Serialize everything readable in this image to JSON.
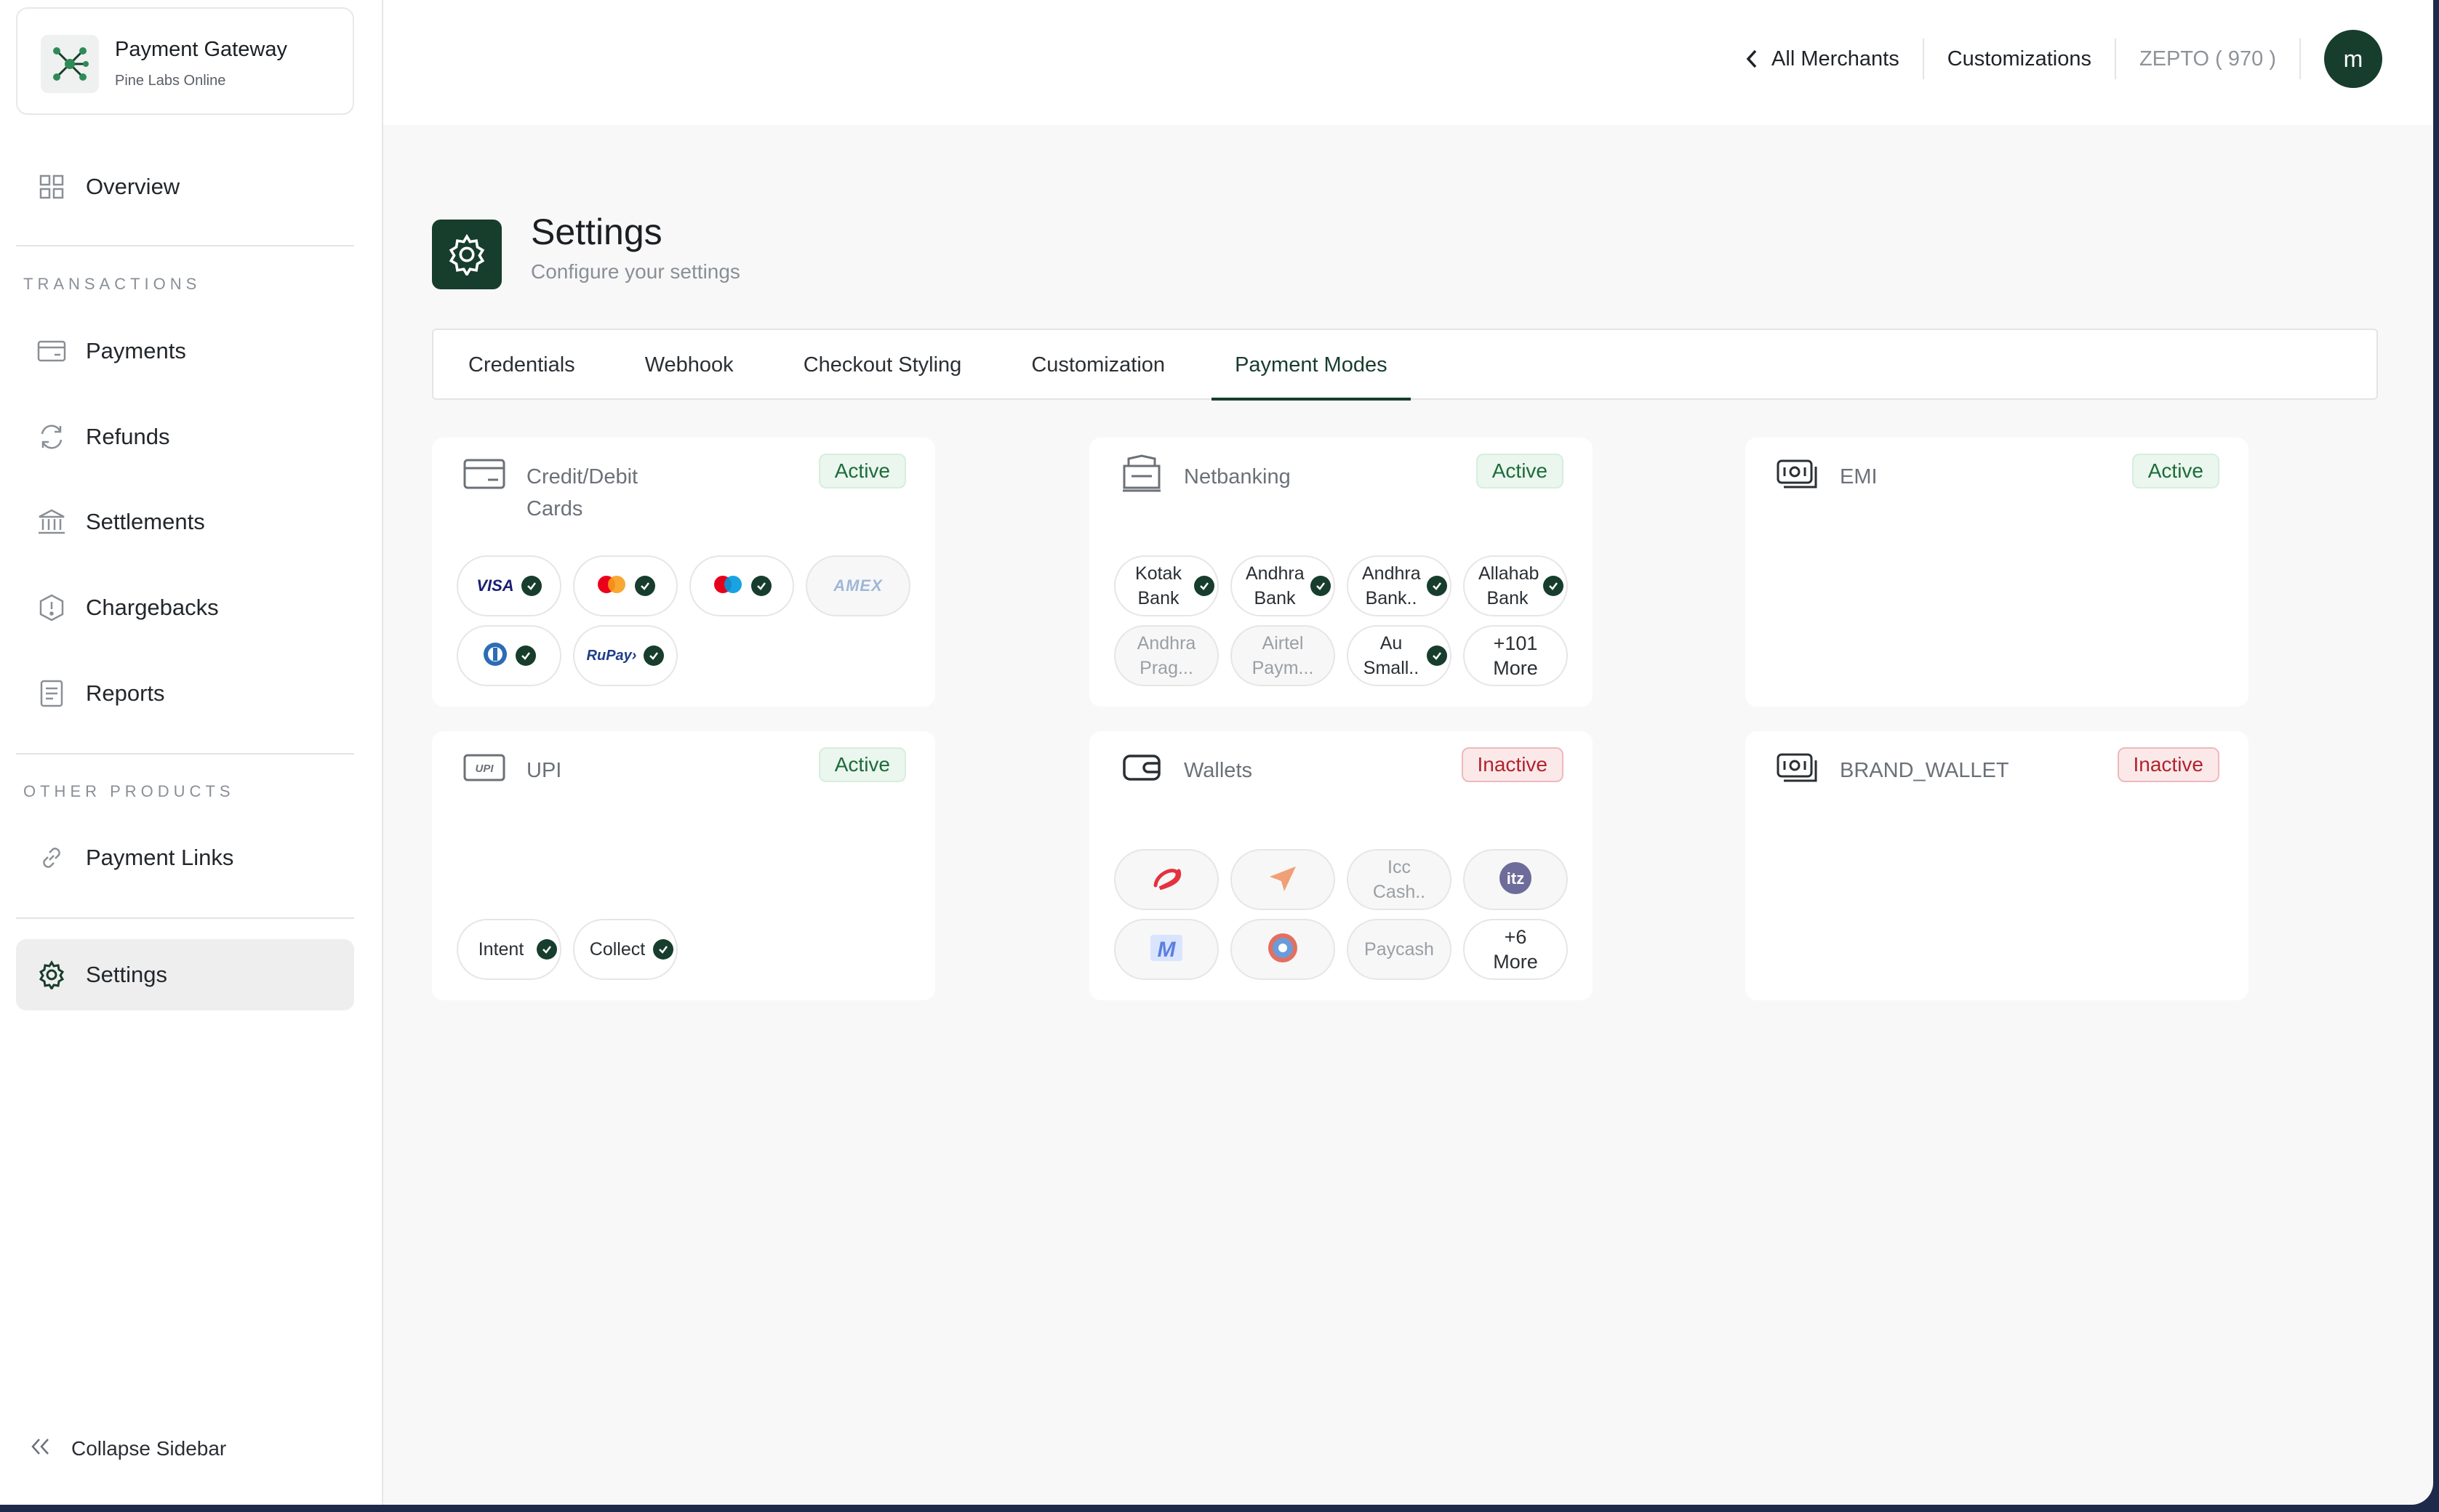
{
  "brand": {
    "title": "Payment Gateway",
    "subtitle": "Pine Labs Online"
  },
  "sidebar": {
    "overview": "Overview",
    "section_transactions": "TRANSACTIONS",
    "payments": "Payments",
    "refunds": "Refunds",
    "settlements": "Settlements",
    "chargebacks": "Chargebacks",
    "reports": "Reports",
    "section_other": "OTHER PRODUCTS",
    "payment_links": "Payment Links",
    "settings": "Settings",
    "collapse": "Collapse Sidebar"
  },
  "topbar": {
    "all_merchants": "All Merchants",
    "customizations": "Customizations",
    "merchant": "ZEPTO ( 970 )",
    "avatar": "m"
  },
  "page": {
    "title": "Settings",
    "subtitle": "Configure your settings"
  },
  "tabs": [
    "Credentials",
    "Webhook",
    "Checkout Styling",
    "Customization",
    "Payment Modes"
  ],
  "cards": {
    "cards": {
      "title": "Credit/Debit Cards",
      "status": "Active",
      "networks": [
        {
          "label": "VISA",
          "enabled": true
        },
        {
          "label": "mastercard",
          "enabled": true
        },
        {
          "label": "maestro",
          "enabled": true
        },
        {
          "label": "AMEX",
          "enabled": false
        },
        {
          "label": "Diners",
          "enabled": true
        },
        {
          "label": "RuPay",
          "enabled": true
        }
      ]
    },
    "netbanking": {
      "title": "Netbanking",
      "status": "Active",
      "banks": [
        "Kotak Bank",
        "Andhra Bank",
        "Andhra Bank..",
        "Allahab Bank",
        "Andhra Prag...",
        "Airtel Paym...",
        "Au Small..",
        "+101 More"
      ]
    },
    "emi": {
      "title": "EMI",
      "status": "Active"
    },
    "upi": {
      "title": "UPI",
      "status": "Active",
      "options": [
        "Intent",
        "Collect"
      ]
    },
    "wallets": {
      "title": "Wallets",
      "status": "Inactive",
      "items": [
        "Airtel",
        "Freecharge",
        "Icc Cash..",
        "itz",
        "Mobikwik",
        "Ola Money",
        "Paycash",
        "+6 More"
      ]
    },
    "brand_wallet": {
      "title": "BRAND_WALLET",
      "status": "Inactive"
    }
  },
  "colors": {
    "brand_green": "#173d2d",
    "active_green": "#1d6b3a",
    "inactive_red": "#b2232e"
  }
}
